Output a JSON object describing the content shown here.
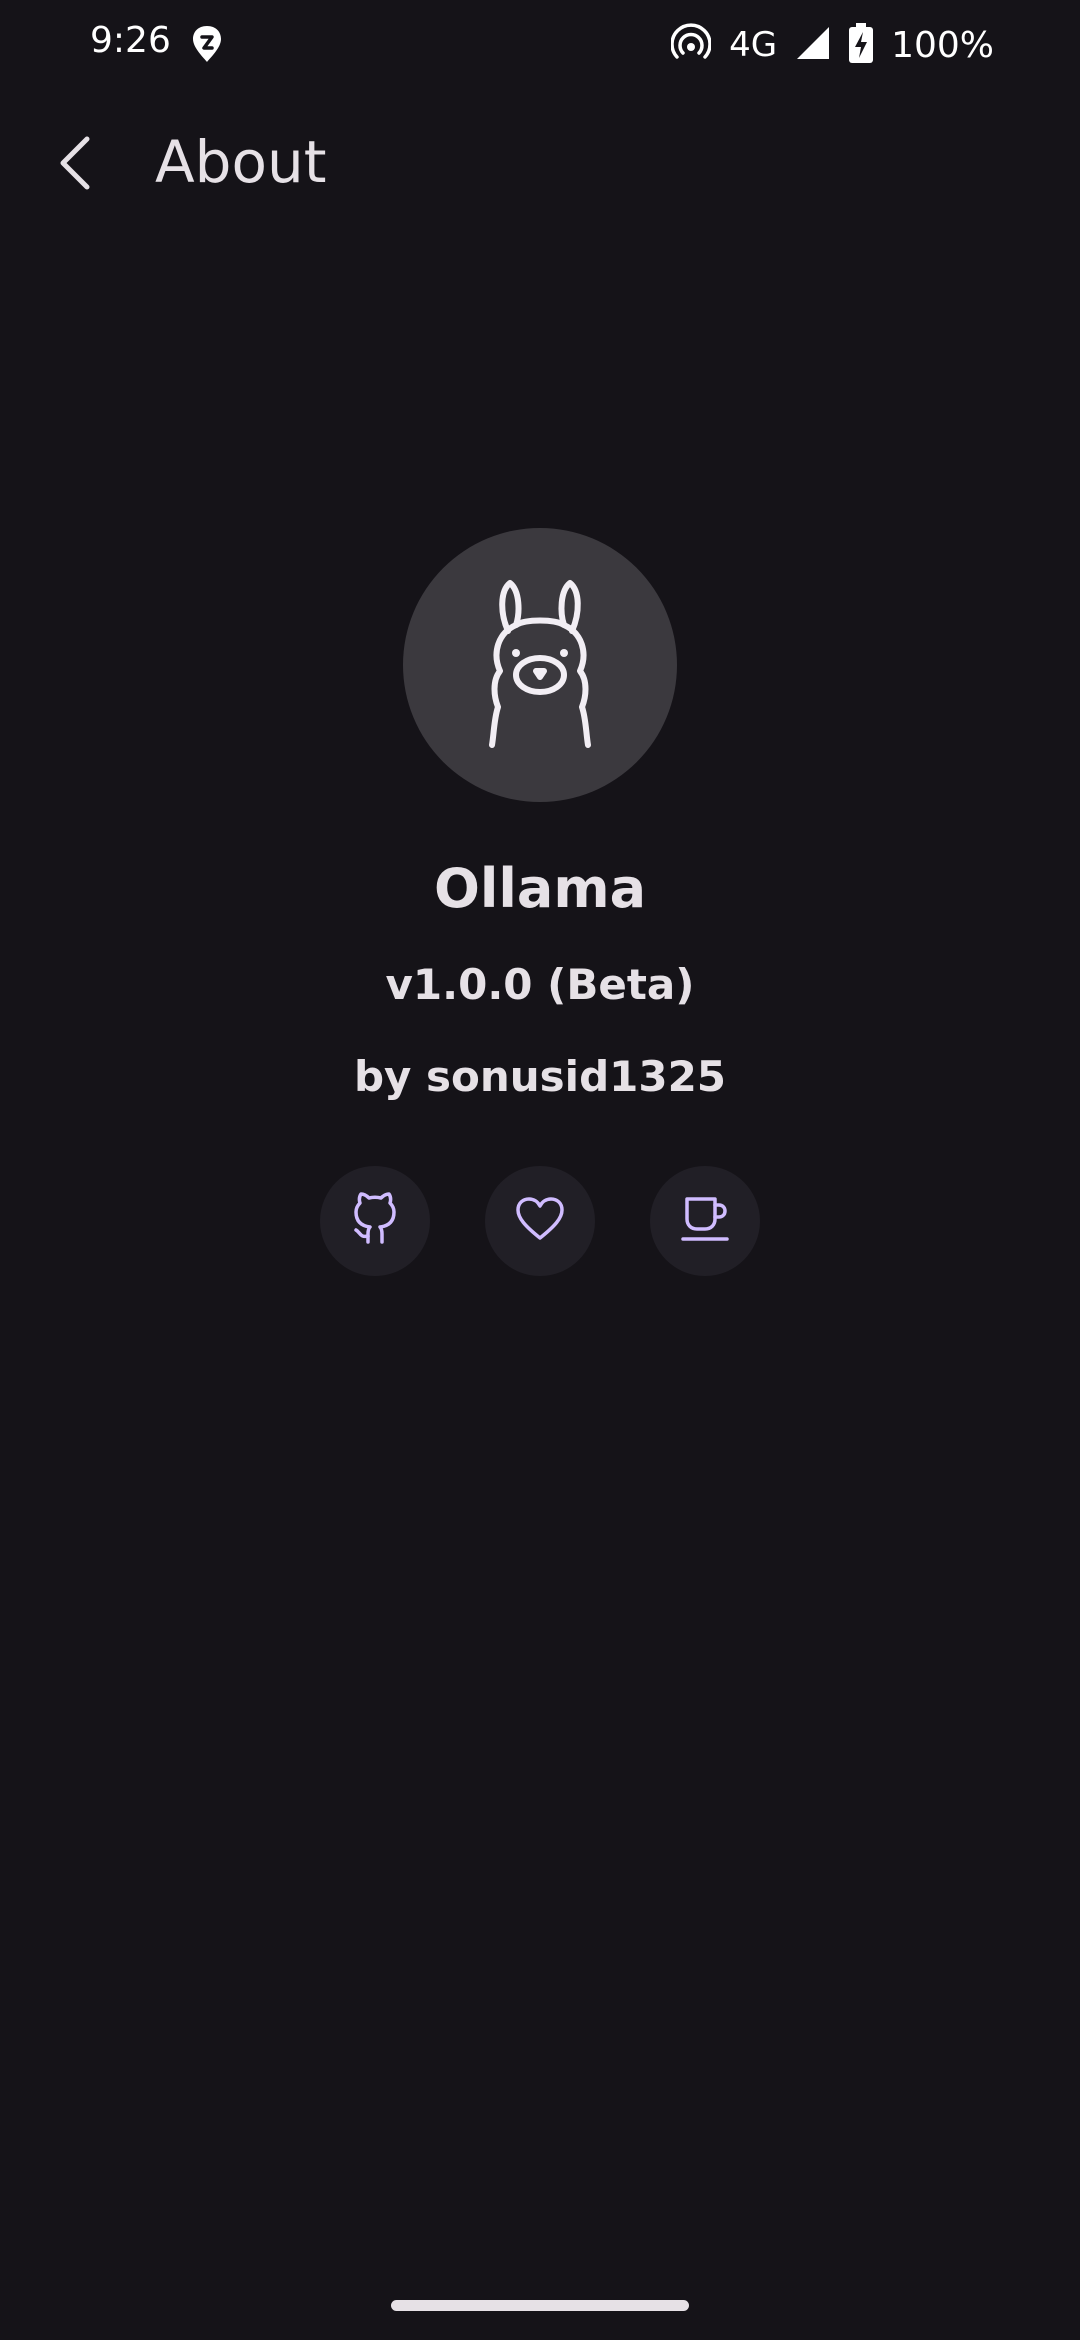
{
  "status_bar": {
    "time": "9:26",
    "network": "4G",
    "battery": "100%",
    "icons": [
      "swiggy-icon",
      "hotspot-icon",
      "signal-icon",
      "battery-charging-icon"
    ]
  },
  "app_bar": {
    "title": "About",
    "back_icon": "back-arrow-icon"
  },
  "app": {
    "logo_icon": "llama-logo-icon",
    "name": "Ollama",
    "version": "v1.0.0 (Beta)",
    "author": "by sonusid1325"
  },
  "actions": [
    {
      "icon": "github-icon"
    },
    {
      "icon": "heart-icon"
    },
    {
      "icon": "coffee-icon"
    }
  ],
  "colors": {
    "background": "#151318",
    "text": "#e6e1e6",
    "accent": "#d0bcff",
    "logo_circle": "#3b393e",
    "action_bg": "#211f26"
  }
}
